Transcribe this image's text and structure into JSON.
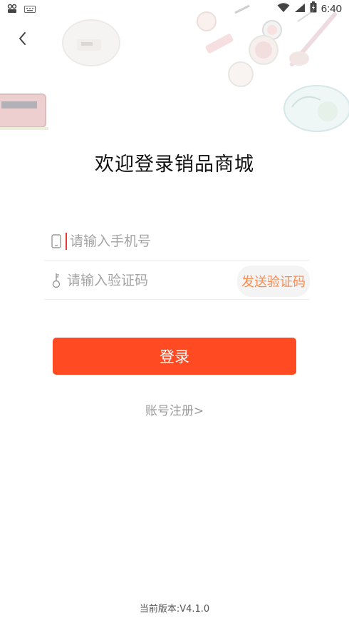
{
  "status_bar": {
    "time": "6:40",
    "icons": [
      "vpn-icon",
      "keyboard-icon",
      "wifi-icon",
      "signal-icon",
      "battery-icon"
    ]
  },
  "header": {
    "back_icon": "chevron-left-icon"
  },
  "title": "欢迎登录销品商城",
  "phone_field": {
    "icon": "phone-icon",
    "placeholder": "请输入手机号",
    "value": ""
  },
  "code_field": {
    "icon": "key-icon",
    "placeholder": "请输入验证码",
    "value": "",
    "send_button": "发送验证码"
  },
  "login_button": "登录",
  "register_link": "账号注册>",
  "version": "当前版本:V4.1.0",
  "colors": {
    "primary": "#ff4a22",
    "send_code_text": "#ff8a4c",
    "placeholder": "#a3a3a3",
    "caret": "#e53935"
  }
}
